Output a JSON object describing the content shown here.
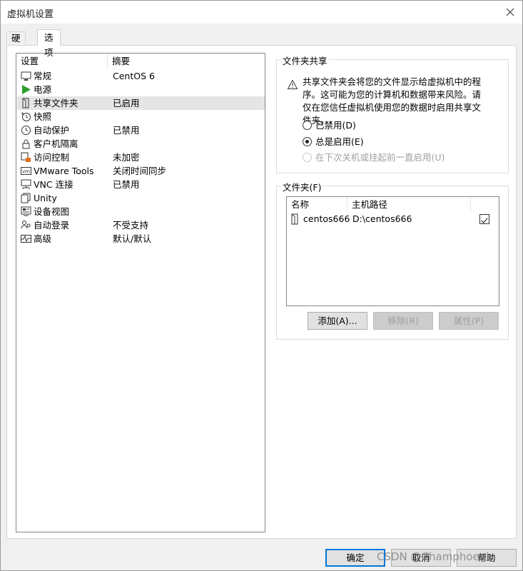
{
  "window": {
    "title": "虚拟机设置",
    "close_icon": "close-icon"
  },
  "tabs": [
    {
      "label": "硬件",
      "active": false
    },
    {
      "label": "选项",
      "active": true
    }
  ],
  "settings_list": {
    "columns": [
      "设置",
      "摘要"
    ],
    "items": [
      {
        "name": "常规",
        "summary": "CentOS 6",
        "icon": "monitor-icon"
      },
      {
        "name": "电源",
        "summary": "",
        "icon": "play-icon"
      },
      {
        "name": "共享文件夹",
        "summary": "已启用",
        "icon": "shared-folder-icon",
        "selected": true
      },
      {
        "name": "快照",
        "summary": "",
        "icon": "snapshot-icon"
      },
      {
        "name": "自动保护",
        "summary": "已禁用",
        "icon": "clock-icon"
      },
      {
        "name": "客户机隔离",
        "summary": "",
        "icon": "lock-icon"
      },
      {
        "name": "访问控制",
        "summary": "未加密",
        "icon": "access-control-icon"
      },
      {
        "name": "VMware Tools",
        "summary": "关闭时间同步",
        "icon": "vm-icon"
      },
      {
        "name": "VNC 连接",
        "summary": "已禁用",
        "icon": "network-icon"
      },
      {
        "name": "Unity",
        "summary": "",
        "icon": "unity-icon"
      },
      {
        "name": "设备视图",
        "summary": "",
        "icon": "device-view-icon"
      },
      {
        "name": "自动登录",
        "summary": "不受支持",
        "icon": "users-icon"
      },
      {
        "name": "高级",
        "summary": "默认/默认",
        "icon": "pulse-icon"
      }
    ]
  },
  "folder_sharing": {
    "group_title": "文件夹共享",
    "warning_text": "共享文件夹会将您的文件显示给虚拟机中的程序。这可能为您的计算机和数据带来风险。请仅在您信任虚拟机使用您的数据时启用共享文件夹。",
    "warning_icon": "warning-icon",
    "options": [
      {
        "label": "已禁用(D)",
        "checked": false,
        "enabled": true
      },
      {
        "label": "总是启用(E)",
        "checked": true,
        "enabled": true
      },
      {
        "label": "在下次关机或挂起前一直启用(U)",
        "checked": false,
        "enabled": false
      }
    ]
  },
  "folders": {
    "group_title": "文件夹(F)",
    "columns": [
      "名称",
      "主机路径"
    ],
    "rows": [
      {
        "name": "centos666",
        "host_path": "D:\\centos666",
        "enabled": true
      }
    ],
    "buttons": {
      "add": "添加(A)...",
      "remove": "移除(R)",
      "properties": "属性(P)"
    }
  },
  "footer": {
    "ok": "确定",
    "cancel": "取消",
    "help": "帮助"
  },
  "watermark": "CSDN @Champhoenix"
}
